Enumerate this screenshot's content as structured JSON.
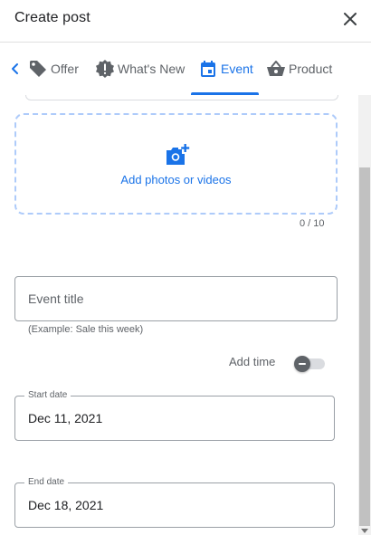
{
  "header": {
    "title": "Create post",
    "close_icon": "close-icon"
  },
  "tabs": {
    "back_icon": "chevron-left-icon",
    "items": [
      {
        "label": "Offer",
        "icon": "tag-icon",
        "active": false
      },
      {
        "label": "What's New",
        "icon": "alert-badge-icon",
        "active": false
      },
      {
        "label": "Event",
        "icon": "calendar-icon",
        "active": true
      },
      {
        "label": "Product",
        "icon": "basket-icon",
        "active": false
      }
    ]
  },
  "upload": {
    "label": "Add photos or videos",
    "icon": "add-photo-icon",
    "count": "0 / 10"
  },
  "event_title": {
    "placeholder": "Event title",
    "helper": "(Example: Sale this week)"
  },
  "add_time": {
    "label": "Add time",
    "enabled": false
  },
  "start_date": {
    "label": "Start date",
    "value": "Dec 11, 2021"
  },
  "end_date": {
    "label": "End date",
    "value": "Dec 18, 2021"
  },
  "colors": {
    "accent": "#1a73e8",
    "text": "#202124",
    "muted": "#5f6368",
    "border": "#9aa0a6"
  }
}
